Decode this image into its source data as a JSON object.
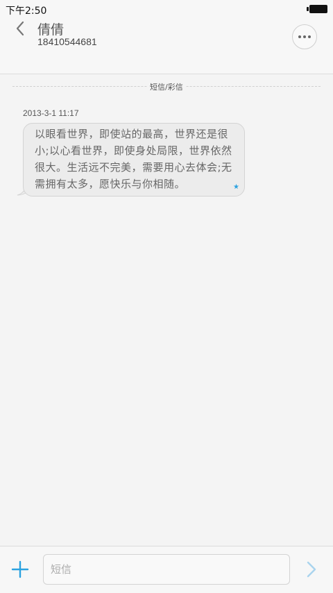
{
  "status_bar": {
    "time": "下午2:50"
  },
  "header": {
    "contact_name": "倩倩",
    "contact_number": "18410544681"
  },
  "thread": {
    "divider_label": "短信/彩信",
    "messages": [
      {
        "timestamp": "2013-3-1 11:17",
        "text": "以眼看世界，即使站的最高，世界还是很小;以心看世界，即使身处局限，世界依然很大。生活远不完美，需要用心去体会;无需拥有太多，愿快乐与你相随。",
        "status_icon": "star-icon"
      }
    ]
  },
  "composer": {
    "input_placeholder": "短信",
    "input_value": ""
  },
  "icons": {
    "back": "chevron-left-icon",
    "more": "more-icon",
    "add": "plus-icon",
    "send": "chevron-right-icon"
  },
  "colors": {
    "accent": "#2ba2e0",
    "send_icon": "#a9d4ee"
  }
}
